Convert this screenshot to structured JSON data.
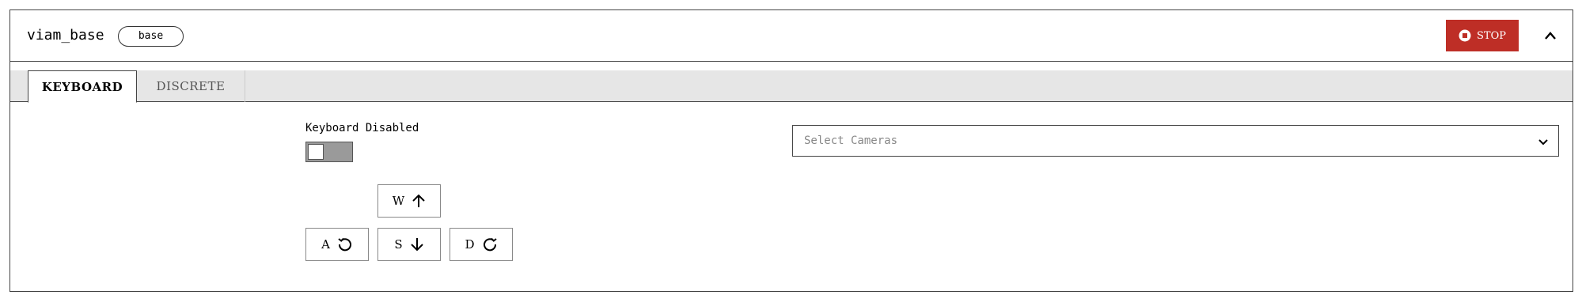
{
  "header": {
    "title": "viam_base",
    "badge": "base",
    "stop_label": "STOP",
    "stop_color": "#be2e26",
    "stop_icon": "stop-circle-icon",
    "collapse_icon": "chevron-up-icon"
  },
  "tabs": [
    {
      "label": "KEYBOARD",
      "active": true
    },
    {
      "label": "DISCRETE",
      "active": false
    }
  ],
  "keyboard": {
    "status_label": "Keyboard Disabled",
    "toggle_on": false,
    "keys": {
      "forward": {
        "letter": "W",
        "icon": "arrow-up-icon"
      },
      "left": {
        "letter": "A",
        "icon": "rotate-ccw-icon"
      },
      "backward": {
        "letter": "S",
        "icon": "arrow-down-icon"
      },
      "right": {
        "letter": "D",
        "icon": "rotate-cw-icon"
      }
    }
  },
  "cameras": {
    "placeholder": "Select Cameras",
    "chevron_icon": "chevron-down-icon"
  }
}
